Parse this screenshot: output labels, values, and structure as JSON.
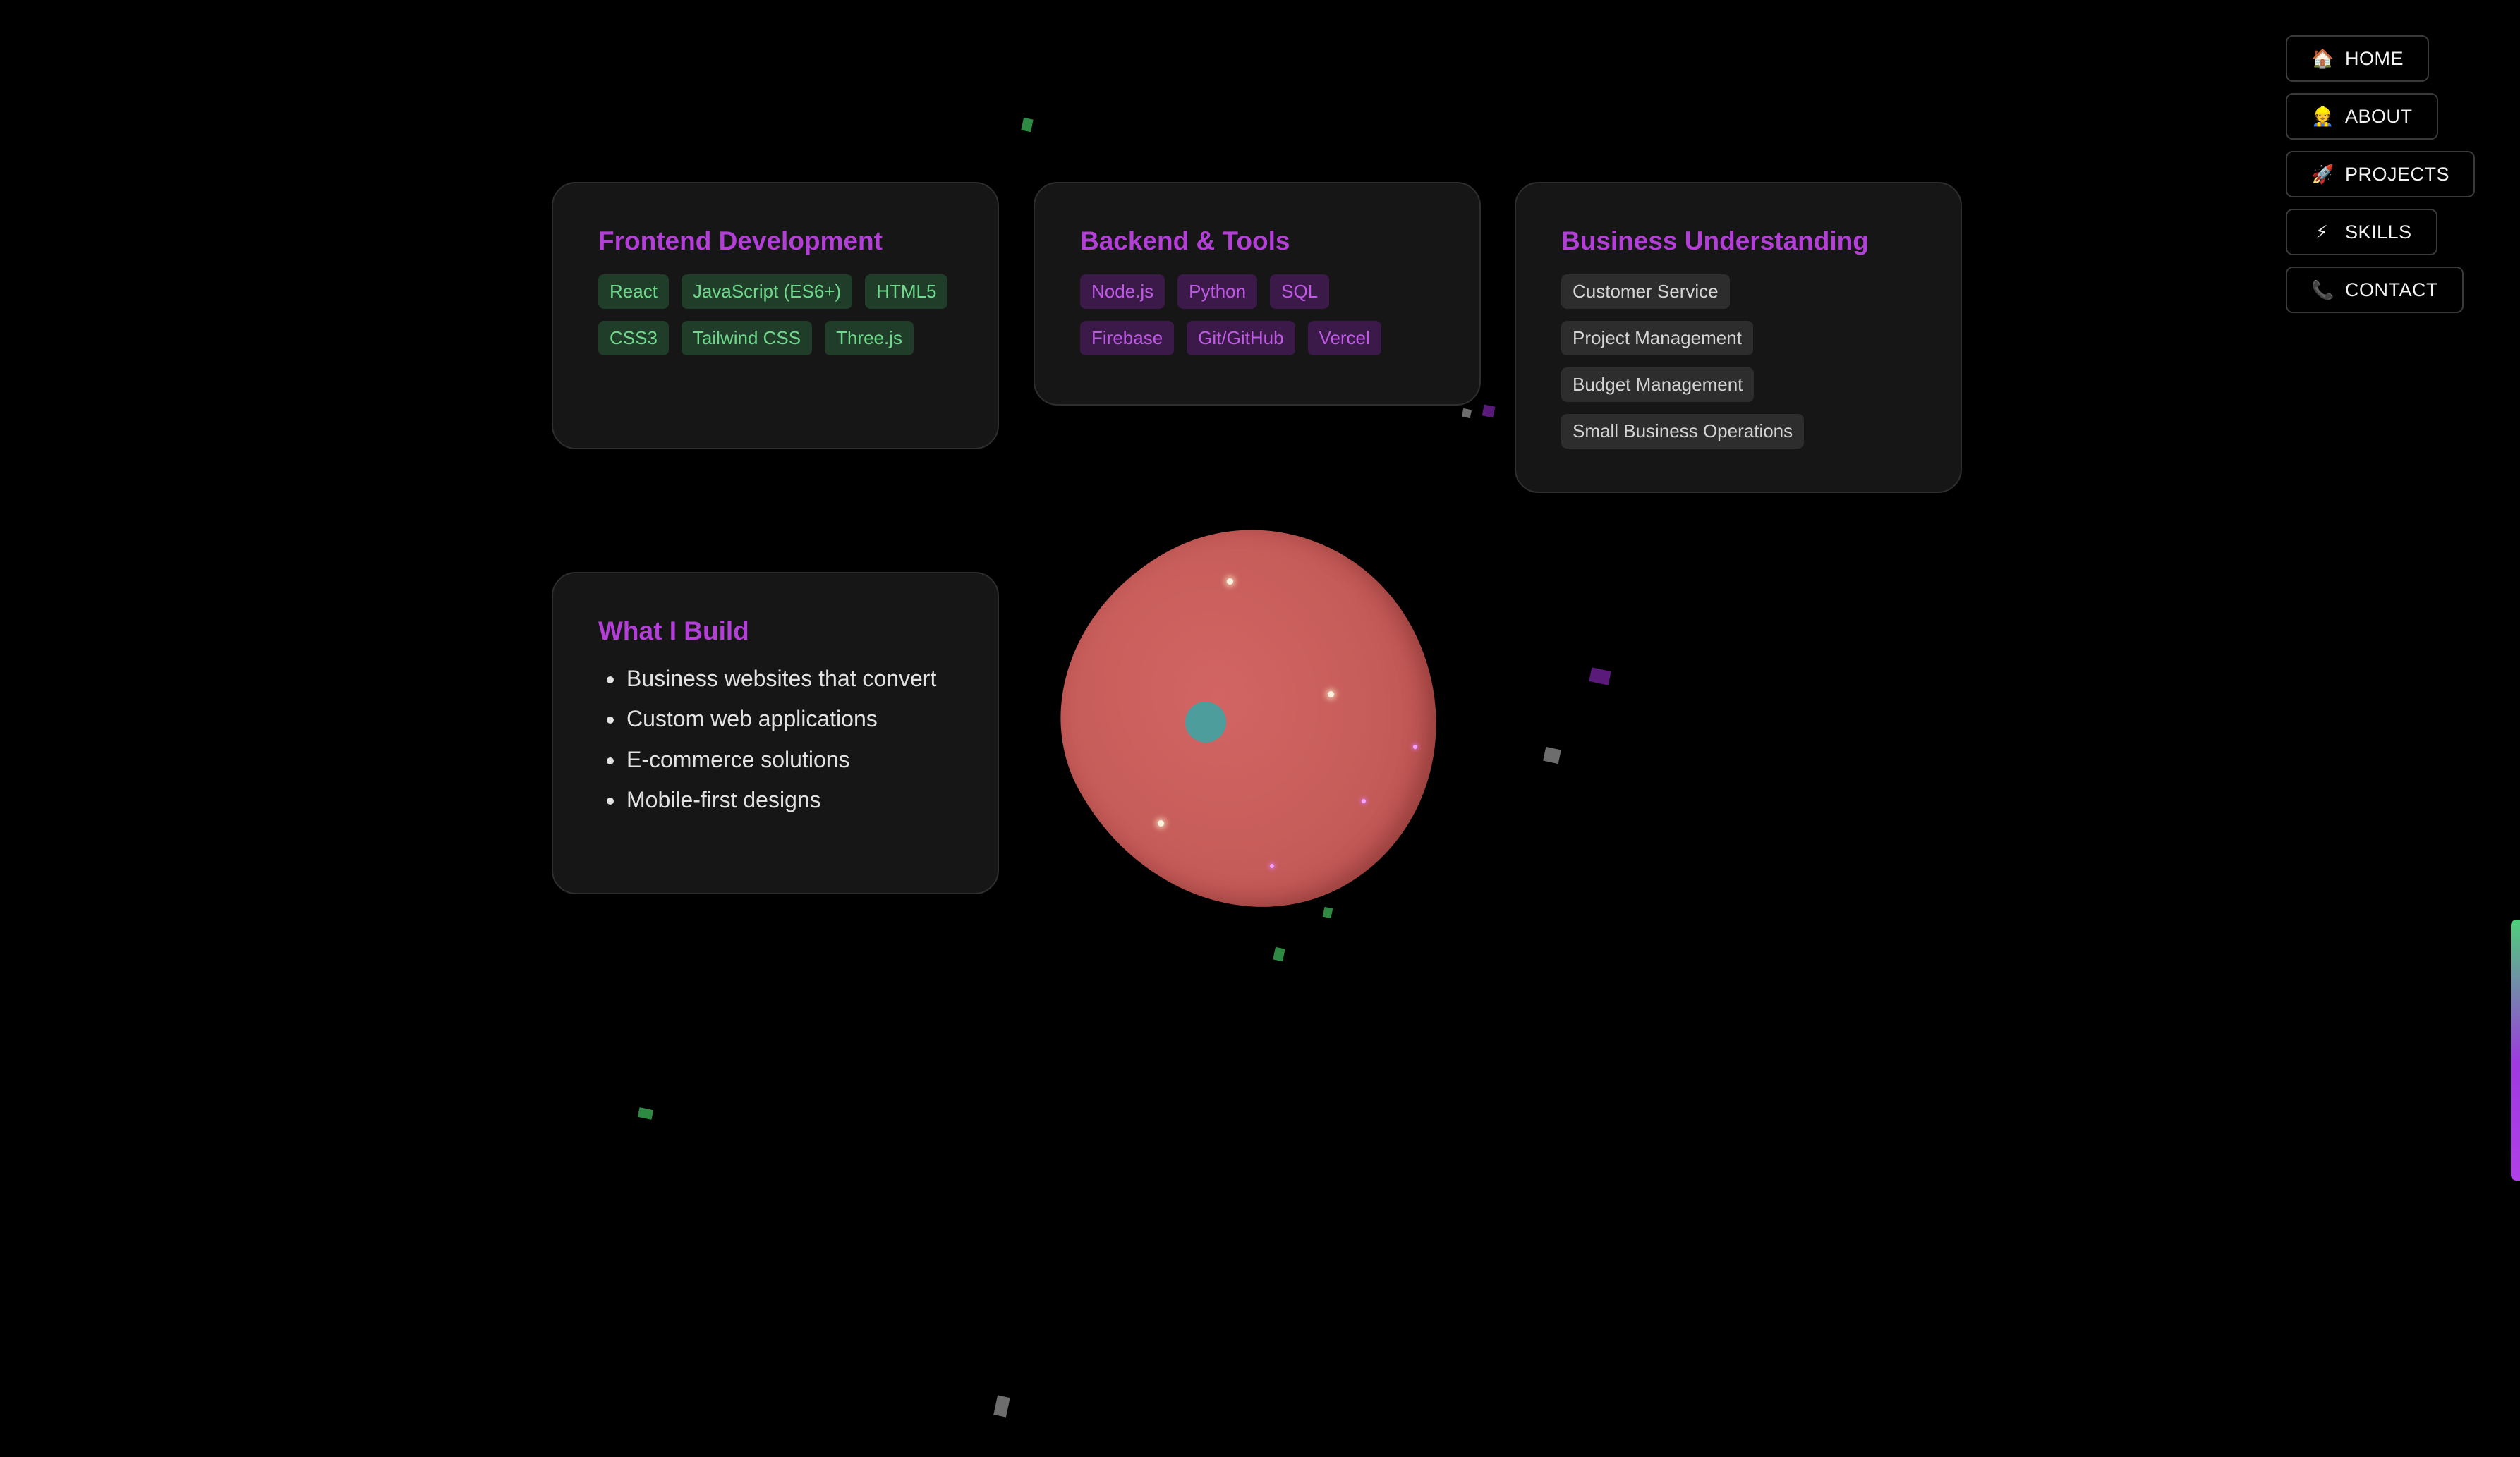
{
  "nav": {
    "items": [
      {
        "icon": "🏠",
        "icon_name": "home-icon",
        "label": "HOME"
      },
      {
        "icon": "👷",
        "icon_name": "person-icon",
        "label": "ABOUT"
      },
      {
        "icon": "🚀",
        "icon_name": "rocket-icon",
        "label": "PROJECTS"
      },
      {
        "icon": "⚡",
        "icon_name": "lightning-icon",
        "label": "SKILLS"
      },
      {
        "icon": "📞",
        "icon_name": "phone-icon",
        "label": "CONTACT"
      }
    ]
  },
  "cards": {
    "frontend": {
      "title": "Frontend Development",
      "tags": [
        "React",
        "JavaScript (ES6+)",
        "HTML5",
        "CSS3",
        "Tailwind CSS",
        "Three.js"
      ]
    },
    "backend": {
      "title": "Backend & Tools",
      "tags": [
        "Node.js",
        "Python",
        "SQL",
        "Firebase",
        "Git/GitHub",
        "Vercel"
      ]
    },
    "business": {
      "title": "Business Understanding",
      "tags": [
        "Customer Service",
        "Project Management",
        "Budget Management",
        "Small Business Operations"
      ]
    },
    "build": {
      "title": "What I Build",
      "items": [
        "Business websites that convert",
        "Custom web applications",
        "E-commerce solutions",
        "Mobile-first designs"
      ]
    }
  },
  "colors": {
    "accent": "#b43fd8",
    "tag_green_bg": "#1f3d28",
    "tag_green_text": "#6fd98b",
    "tag_purple_bg": "#3b1a4a",
    "tag_purple_text": "#c05ae6",
    "blob": "#c65c59"
  }
}
